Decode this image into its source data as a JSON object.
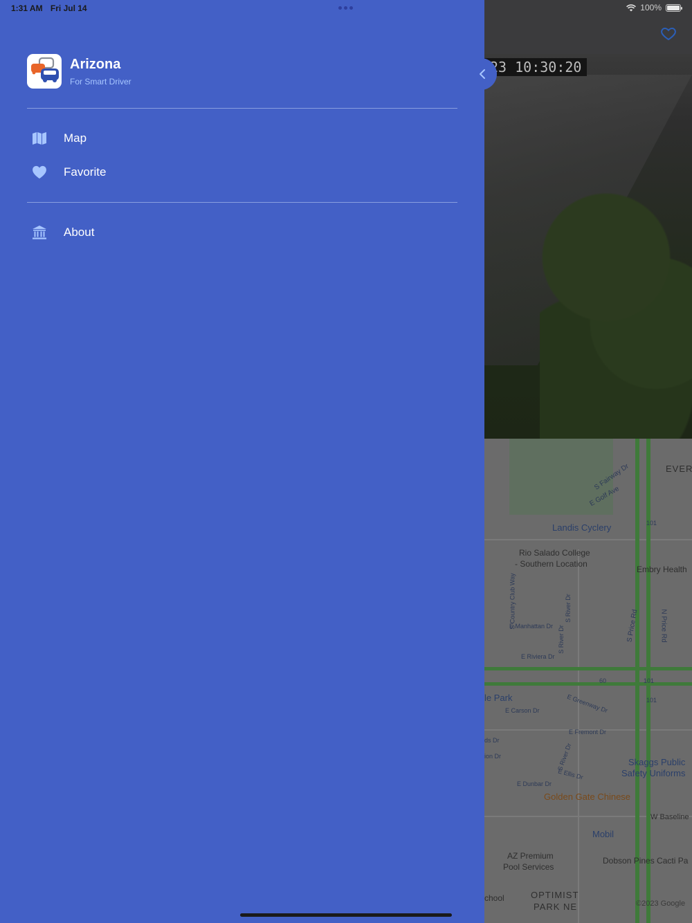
{
  "status_bar": {
    "time": "1:31 AM",
    "date": "Fri Jul 14",
    "battery_text": "100%"
  },
  "drawer": {
    "app_title": "Arizona",
    "app_subtitle": "For Smart Driver",
    "menu": [
      {
        "label": "Map",
        "icon": "map-icon"
      },
      {
        "label": "Favorite",
        "icon": "heart-icon"
      }
    ],
    "secondary_menu": [
      {
        "label": "About",
        "icon": "bank-icon"
      }
    ],
    "colors": {
      "background": "#4360c6",
      "icon": "#a7c6ff"
    }
  },
  "background": {
    "camera_timestamp": "23  10:30:20",
    "map_labels": {
      "ever": "EVER",
      "fairway": "S Fairway Dr",
      "golf": "E Golf Ave",
      "landis": "Landis Cyclery",
      "hwy101_a": "101",
      "rio1": "Rio Salado College",
      "rio2": "- Southern Location",
      "embry": "Embry Health",
      "country_club": "S Country Club Way",
      "river_dr": "S River Dr",
      "price1": "S Price Rd",
      "price2": "N Price Rd",
      "manhattan": "E Manhattan Dr",
      "river_dr2": "S River Dr",
      "riviera": "E Riviera Dr",
      "hwy60": "60",
      "hwy101_b": "101",
      "hwy101_c": "101",
      "park": "le Park",
      "greenway": "E Greenway Dr",
      "carson": "E Carson Dr",
      "fremont": "E Fremont Dr",
      "ds_dr": "ds Dr",
      "ion_dr": "ion Dr",
      "river_dr3": "S River Dr",
      "ellis": "E Ellis Dr",
      "skaggs1": "Skaggs Public",
      "skaggs2": "Safety Uniforms",
      "dunbar": "E Dunbar Dr",
      "golden_gate": "Golden Gate Chinese",
      "baseline": "W Baseline",
      "mobil": "Mobil",
      "az1": "AZ Premium",
      "az2": "Pool Services",
      "dobson": "Dobson Pines Cacti Pa",
      "school": "chool",
      "optimist1": "OPTIMIST",
      "optimist2": "PARK NE",
      "copyright": "©2023 Google"
    }
  }
}
